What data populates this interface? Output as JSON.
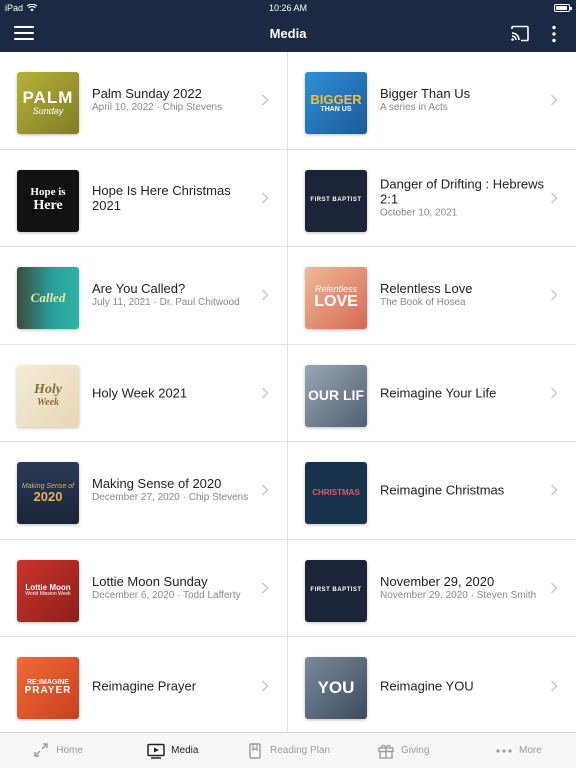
{
  "status": {
    "device": "iPad",
    "time": "10:26 AM",
    "battery_level": 0.9
  },
  "nav": {
    "title": "Media"
  },
  "thumbs": {
    "palm": {
      "line1": "PALM",
      "line2": "Sunday"
    },
    "bigger": {
      "line1": "BIGGER",
      "line2": "THAN US"
    },
    "hope": {
      "line1": "Hope is",
      "line2": "Here"
    },
    "fbc": {
      "line1": "FIRST BAPTIST"
    },
    "called": {
      "line1": "Called"
    },
    "relentless": {
      "line1": "Relentless",
      "line2": "LOVE"
    },
    "holy": {
      "line1": "Holy",
      "line2": "Week"
    },
    "reimagine_life": {
      "line1": "OUR LIF"
    },
    "sense": {
      "line1": "Making Sense of",
      "line2": "2020"
    },
    "christmas": {
      "line1": "CHRISTMAS"
    },
    "lottie": {
      "line1": "Lottie Moon",
      "line2": "World Mission Week"
    },
    "prayer": {
      "line1": "RE:IMAGINE",
      "line2": "PRAYER"
    },
    "you": {
      "line1": "YOU"
    }
  },
  "items": [
    {
      "title": "Palm Sunday 2022",
      "subtitle": "April 10, 2022 · Chip Stevens"
    },
    {
      "title": "Bigger Than Us",
      "subtitle": "A series in Acts"
    },
    {
      "title": "Hope Is Here Christmas 2021",
      "subtitle": ""
    },
    {
      "title": "Danger of Drifting : Hebrews 2:1",
      "subtitle": "October 10, 2021"
    },
    {
      "title": "Are You Called?",
      "subtitle": "July 11, 2021 · Dr. Paul Chitwood"
    },
    {
      "title": "Relentless Love",
      "subtitle": "The Book of Hosea"
    },
    {
      "title": "Holy Week 2021",
      "subtitle": ""
    },
    {
      "title": "Reimagine Your Life",
      "subtitle": ""
    },
    {
      "title": "Making Sense of 2020",
      "subtitle": "December 27, 2020 · Chip Stevens"
    },
    {
      "title": "Reimagine Christmas",
      "subtitle": ""
    },
    {
      "title": "Lottie Moon Sunday",
      "subtitle": "December 6, 2020 · Todd Lafferty"
    },
    {
      "title": "November 29, 2020",
      "subtitle": "November 29, 2020 · Steven Smith"
    },
    {
      "title": "Reimagine Prayer",
      "subtitle": ""
    },
    {
      "title": "Reimagine YOU",
      "subtitle": ""
    }
  ],
  "tabs": [
    {
      "label": "Home",
      "icon": "home-icon"
    },
    {
      "label": "Media",
      "icon": "media-icon",
      "active": true
    },
    {
      "label": "Reading Plan",
      "icon": "book-icon"
    },
    {
      "label": "Giving",
      "icon": "gift-icon"
    },
    {
      "label": "More",
      "icon": "more-dots-icon"
    }
  ],
  "colors": {
    "nav_bg": "#1c2942",
    "divider": "#e2e2e2",
    "tab_bg": "#f7f7f7"
  }
}
